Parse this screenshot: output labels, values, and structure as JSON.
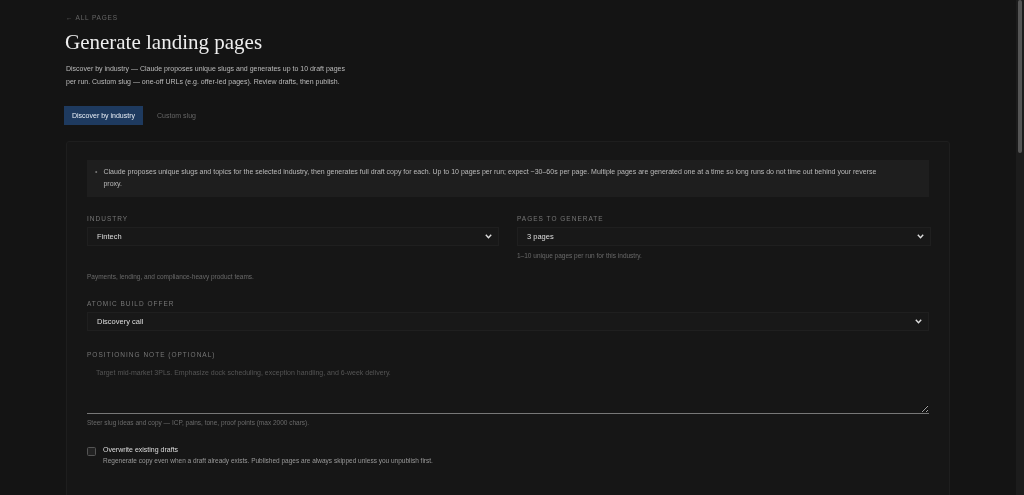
{
  "back_link": "← ALL PAGES",
  "title": "Generate landing pages",
  "intro": "Discover by industry — Claude proposes unique slugs and generates up to 10 draft pages per run. Custom slug — one-off URLs (e.g. offer-led pages). Review drafts, then publish.",
  "tabs": [
    {
      "label": "Discover by industry",
      "selected": true
    },
    {
      "label": "Custom slug",
      "selected": false
    }
  ],
  "notice": {
    "bullet": "•",
    "text": "Claude proposes unique slugs and topics for the selected industry, then generates full draft copy for each. Up to 10 pages per run; expect ~30–60s per page. Multiple pages are generated one at a time so long runs do not time out behind your reverse proxy."
  },
  "industry": {
    "label": "INDUSTRY",
    "value": "Fintech",
    "hint": "Payments, lending, and compliance-heavy product teams."
  },
  "pages_to_generate": {
    "label": "PAGES TO GENERATE",
    "value": "3 pages",
    "hint": "1–10 unique pages per run for this industry."
  },
  "offer": {
    "label": "ATOMIC BUILD OFFER",
    "value": "Discovery call"
  },
  "positioning_note": {
    "label": "POSITIONING NOTE (OPTIONAL)",
    "placeholder": "Target mid-market 3PLs. Emphasize dock scheduling, exception handling, and 6-week delivery.",
    "hint": "Steer slug ideas and copy — ICP, pains, tone, proof points (max 2000 chars)."
  },
  "overwrite": {
    "label": "Overwrite existing drafts",
    "checked": false,
    "description": "Regenerate copy even when a draft already exists. Published pages are always skipped unless you unpublish first."
  }
}
